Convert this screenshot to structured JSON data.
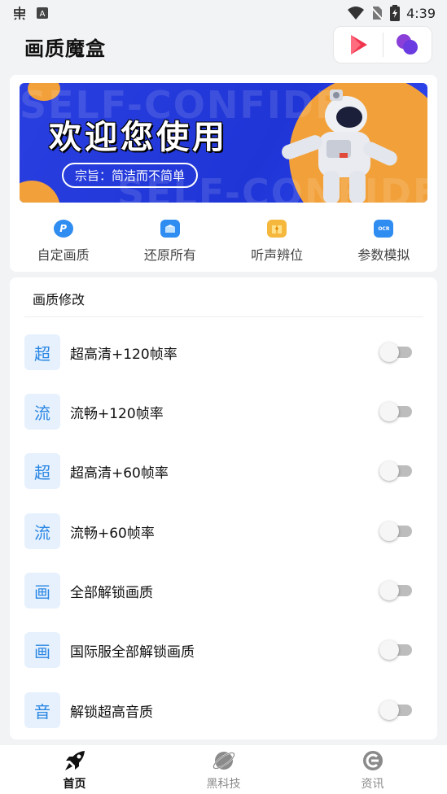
{
  "status_bar": {
    "time": "4:39"
  },
  "header": {
    "title": "画质魔盒"
  },
  "banner": {
    "title": "欢迎您使用",
    "slogan": "宗旨：简洁而不简单",
    "bg_text_1": "SELF-CONFIDE",
    "bg_text_2": "SELF-CONFIDEN"
  },
  "quick_actions": [
    {
      "label": "自定画质",
      "icon": "p-icon",
      "color": "#2f8cf0",
      "glyph": "P"
    },
    {
      "label": "还原所有",
      "icon": "restore-icon",
      "color": "#2f8cf0",
      "glyph": ""
    },
    {
      "label": "听声辨位",
      "icon": "sound-icon",
      "color": "#f5b83d",
      "glyph": ""
    },
    {
      "label": "参数模拟",
      "icon": "ocr-icon",
      "color": "#2f8cf0",
      "glyph": "OCR"
    }
  ],
  "settings": {
    "section_title": "画质修改",
    "rows": [
      {
        "badge": "超",
        "label": "超高清+120帧率",
        "enabled": false
      },
      {
        "badge": "流",
        "label": "流畅+120帧率",
        "enabled": false
      },
      {
        "badge": "超",
        "label": "超高清+60帧率",
        "enabled": false
      },
      {
        "badge": "流",
        "label": "流畅+60帧率",
        "enabled": false
      },
      {
        "badge": "画",
        "label": "全部解锁画质",
        "enabled": false
      },
      {
        "badge": "画",
        "label": "国际服全部解锁画质",
        "enabled": false
      },
      {
        "badge": "音",
        "label": "解锁超高音质",
        "enabled": false
      }
    ]
  },
  "bottom_nav": [
    {
      "label": "首页",
      "icon": "rocket-icon",
      "active": true
    },
    {
      "label": "黑科技",
      "icon": "planet-icon",
      "active": false
    },
    {
      "label": "资讯",
      "icon": "news-icon",
      "active": false
    }
  ],
  "colors": {
    "accent": "#2a86e4",
    "badge_bg": "#e6f1fd",
    "switch_off": "#bdbdbd"
  }
}
